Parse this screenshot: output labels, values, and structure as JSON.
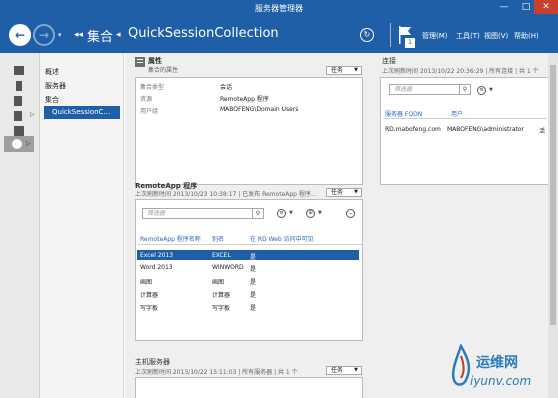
{
  "window": {
    "title": "服务器管理器",
    "min": "—",
    "max": "□",
    "close": "✕"
  },
  "nav": {
    "back_icon": "back-arrow-icon",
    "forward_icon": "forward-arrow-icon",
    "dropdown": "▾",
    "crumb_sep": "◂◂",
    "crumb_sep2": "◂",
    "crumbs": [
      "集合",
      "QuickSessionCollection"
    ],
    "refresh": "↻",
    "notification_count": "1",
    "menus": [
      "管理(M)",
      "工具(T)",
      "视图(V)",
      "帮助(H)"
    ]
  },
  "sidebar": {
    "items": [
      "概述",
      "服务器",
      "集合",
      "QuickSessionC..."
    ]
  },
  "properties": {
    "title": "属性",
    "subtitle": "集合的属性",
    "task_label": "任务",
    "rows": [
      {
        "label": "集合类型",
        "value": "会话"
      },
      {
        "label": "资源",
        "value": "RemoteApp 程序"
      },
      {
        "label": "用户组",
        "value": "MABOFENG\\Domain Users"
      }
    ]
  },
  "connections": {
    "title": "连接",
    "subtitle": "上次刷新时间 2013/10/22 20:36:29 | 所有连接 | 共 1 个",
    "filter_placeholder": "筛选器",
    "columns": [
      "服务器 FQDN",
      "用户"
    ],
    "rows": [
      {
        "server": "RD.mabofeng.com",
        "user": "MABOFENG\\administrator",
        "extra": "活"
      }
    ]
  },
  "remoteapp": {
    "title": "RemoteApp 程序",
    "subtitle": "上次刷新时间 2013/10/23 10:38:17 | 已发布 RemoteApp 程序...",
    "task_label": "任务",
    "filter_placeholder": "筛选器",
    "columns": [
      "RemoteApp 程序名称",
      "别名",
      "在 RD Web 访问中可见"
    ],
    "rows": [
      {
        "name": "Excel 2013",
        "alias": "EXCEL",
        "visible": "是"
      },
      {
        "name": "Word 2013",
        "alias": "WINWORD",
        "visible": "是"
      },
      {
        "name": "画图",
        "alias": "画图",
        "visible": "是"
      },
      {
        "name": "计算器",
        "alias": "计算器",
        "visible": "是"
      },
      {
        "name": "写字板",
        "alias": "写字板",
        "visible": "是"
      }
    ]
  },
  "hosts": {
    "title": "主机服务器",
    "subtitle": "上次刷新时间 2013/10/22 15:11:03 | 所有服务器 | 共 1 个",
    "task_label": "任务"
  },
  "watermark": {
    "cn": "运维网",
    "en": "iyunv.com"
  },
  "colors": {
    "accent": "#1e5fa8",
    "close": "#c7412e",
    "link": "#2b66b8"
  }
}
